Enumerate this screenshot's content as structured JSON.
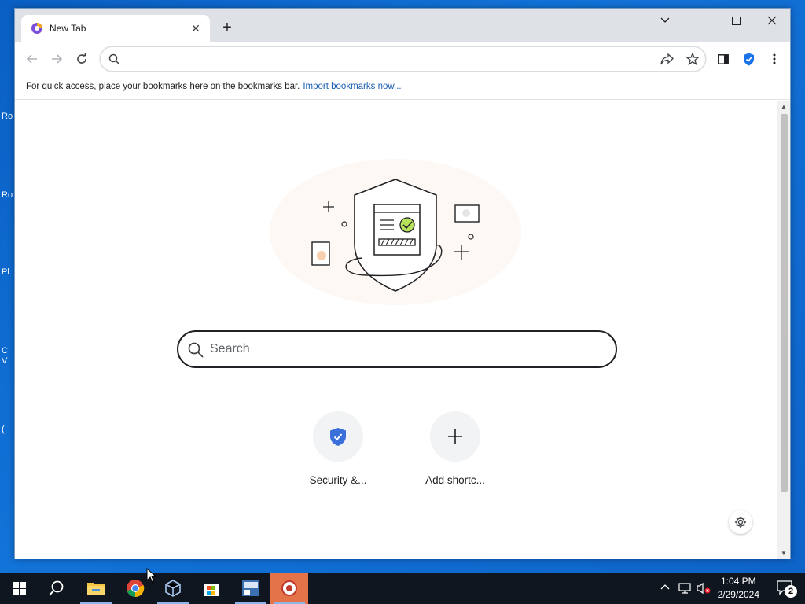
{
  "desktop": {
    "icon_labels": [
      "Ro",
      "Ro",
      "Pl",
      "C V",
      "("
    ]
  },
  "browser": {
    "tab": {
      "title": "New Tab",
      "favicon": "browser-logo-icon"
    },
    "new_tab_icon": "plus-icon",
    "window_controls": [
      "chevron-down-icon",
      "minimize-icon",
      "maximize-icon",
      "close-icon"
    ],
    "toolbar": {
      "back_icon": "back-arrow-icon",
      "forward_icon": "forward-arrow-icon",
      "reload_icon": "reload-icon",
      "address_value": "",
      "share_icon": "share-icon",
      "bookmark_icon": "star-icon",
      "side_panel_icon": "side-panel-icon",
      "extension_icon": "shield-icon",
      "menu_icon": "more-vertical-icon"
    },
    "bookmarks_bar": {
      "text": "For quick access, place your bookmarks here on the bookmarks bar.",
      "link": "Import bookmarks now..."
    }
  },
  "new_tab_page": {
    "search_placeholder": "Search",
    "shortcuts": [
      {
        "label": "Security &...",
        "icon": "shield-check-icon"
      },
      {
        "label": "Add shortc...",
        "icon": "plus-icon"
      }
    ],
    "customize_icon": "gear-icon"
  },
  "taskbar": {
    "items": [
      "windows-start-icon",
      "search-icon",
      "file-explorer-icon",
      "chrome-icon",
      "virtualbox-icon",
      "store-icon",
      "app-icon",
      "browser-app-icon"
    ],
    "clock": {
      "time": "1:04 PM",
      "date": "2/29/2024"
    },
    "notification_count": "2"
  }
}
